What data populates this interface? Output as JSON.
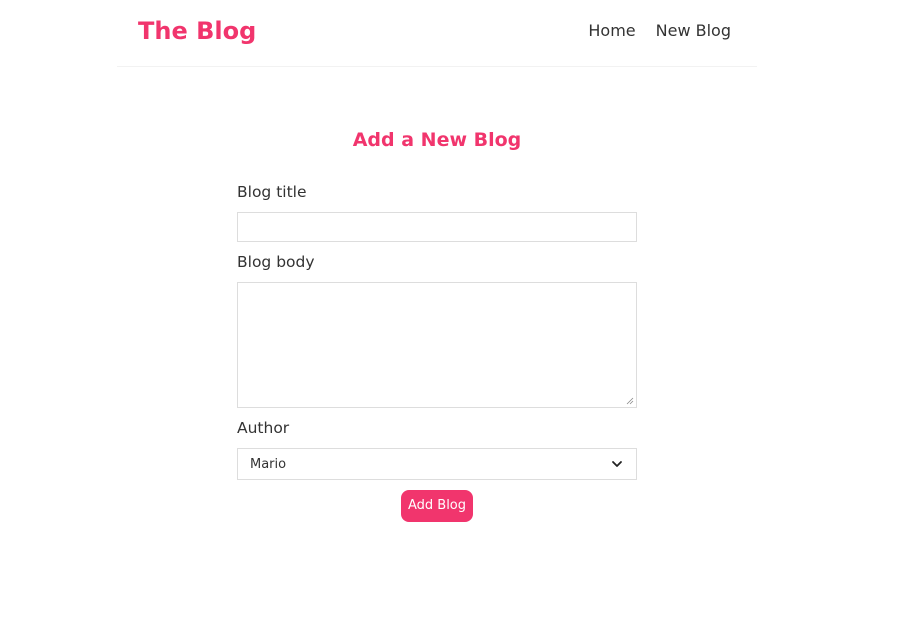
{
  "colors": {
    "accent": "#f1356d",
    "text": "#333333",
    "border": "#dddddd"
  },
  "navbar": {
    "brand": "The Blog",
    "links": [
      {
        "label": "Home"
      },
      {
        "label": "New Blog"
      }
    ]
  },
  "create": {
    "heading": "Add a New Blog",
    "title_label": "Blog title",
    "title_value": "",
    "body_label": "Blog body",
    "body_value": "",
    "author_label": "Author",
    "author_selected": "Mario",
    "author_icon": "chevron-down-icon",
    "submit_label": "Add Blog"
  }
}
